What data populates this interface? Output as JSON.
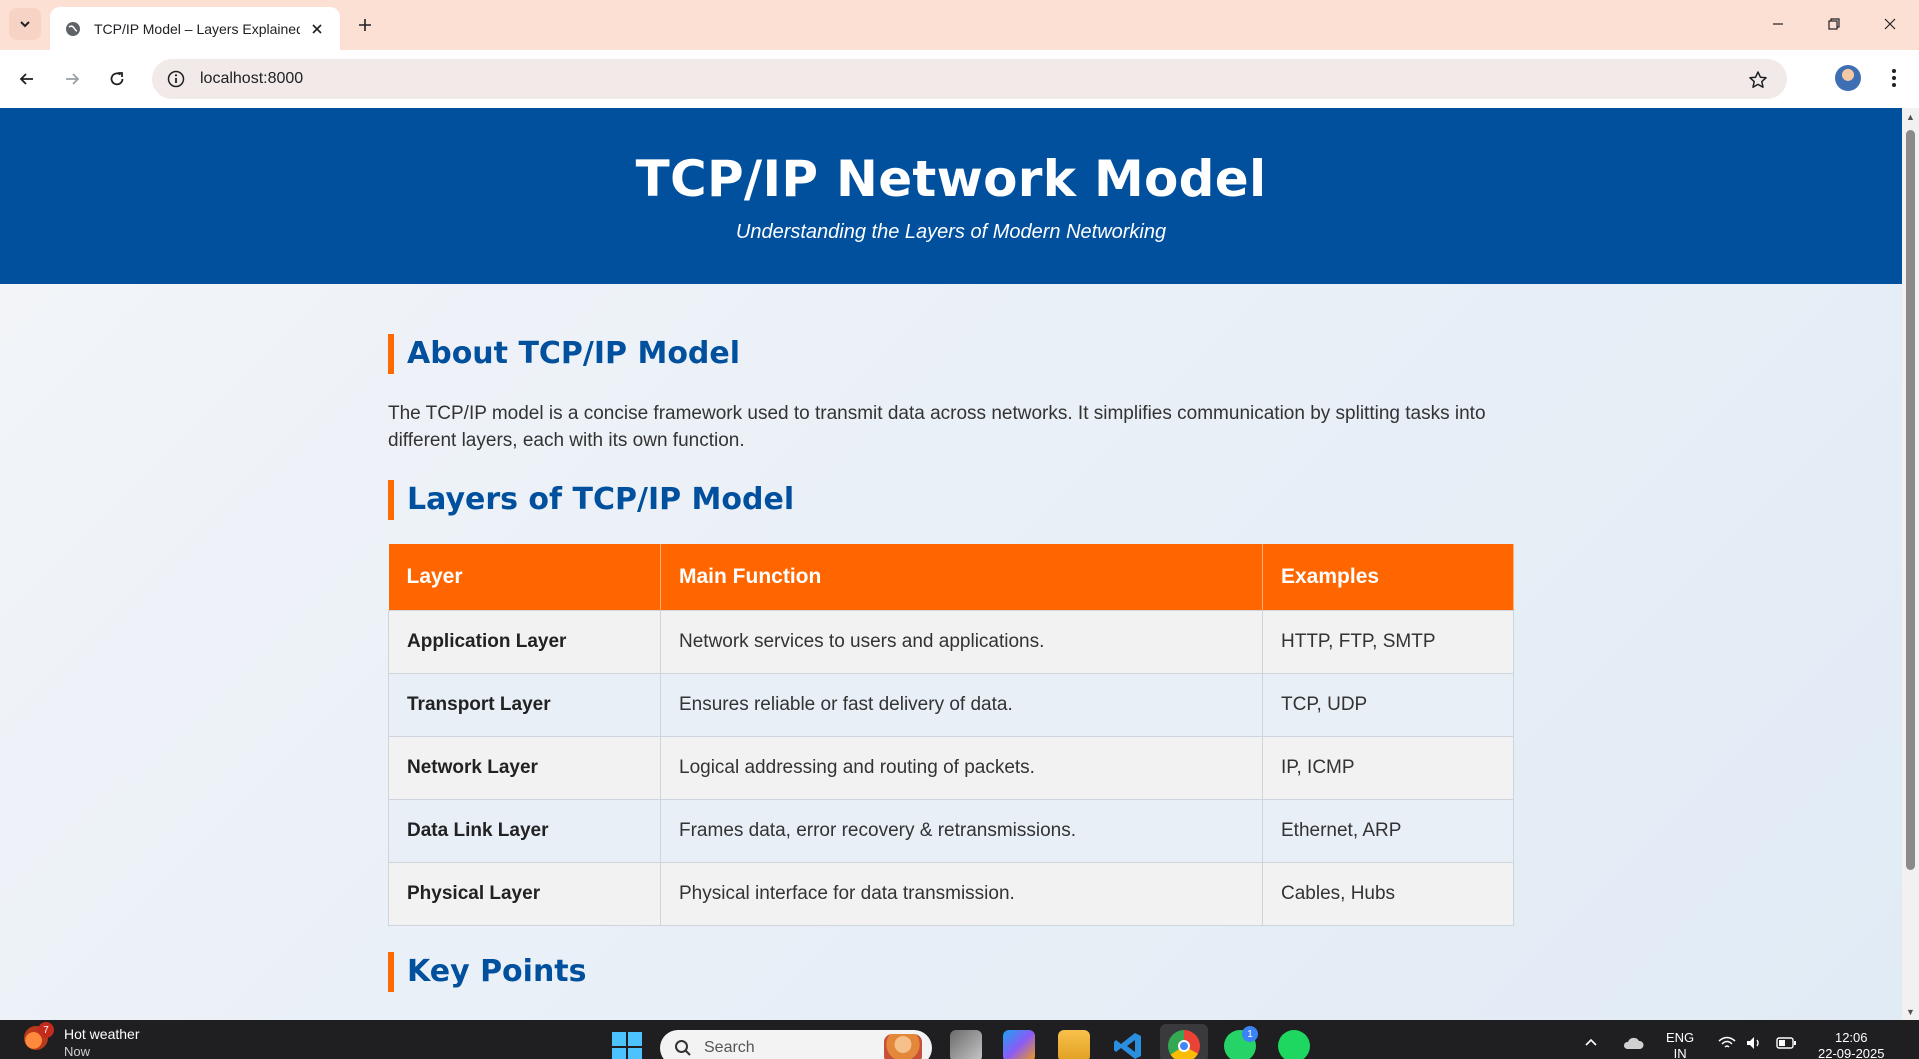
{
  "browser": {
    "tab_title": "TCP/IP Model – Layers Explained",
    "url": "localhost:8000"
  },
  "page": {
    "header": {
      "title": "TCP/IP Network Model",
      "subtitle": "Understanding the Layers of Modern Networking"
    },
    "about": {
      "heading": "About TCP/IP Model",
      "text": "The TCP/IP model is a concise framework used to transmit data across networks. It simplifies communication by splitting tasks into different layers, each with its own function."
    },
    "layers": {
      "heading": "Layers of TCP/IP Model",
      "columns": [
        "Layer",
        "Main Function",
        "Examples"
      ],
      "rows": [
        {
          "layer": "Application Layer",
          "function": "Network services to users and applications.",
          "examples": "HTTP, FTP, SMTP"
        },
        {
          "layer": "Transport Layer",
          "function": "Ensures reliable or fast delivery of data.",
          "examples": "TCP, UDP"
        },
        {
          "layer": "Network Layer",
          "function": "Logical addressing and routing of packets.",
          "examples": "IP, ICMP"
        },
        {
          "layer": "Data Link Layer",
          "function": "Frames data, error recovery & retransmissions.",
          "examples": "Ethernet, ARP"
        },
        {
          "layer": "Physical Layer",
          "function": "Physical interface for data transmission.",
          "examples": "Cables, Hubs"
        }
      ]
    },
    "key_points": {
      "heading": "Key Points"
    }
  },
  "taskbar": {
    "weather_title": "Hot weather",
    "weather_sub": "Now",
    "weather_badge": "7",
    "search_placeholder": "Search",
    "whatsapp_badge": "1",
    "language": "ENG",
    "language_sub": "IN",
    "time": "12:06",
    "date": "22-09-2025"
  },
  "colors": {
    "header_bg": "#00509e",
    "accent_orange": "#ff6600",
    "heading_blue": "#00509e"
  }
}
